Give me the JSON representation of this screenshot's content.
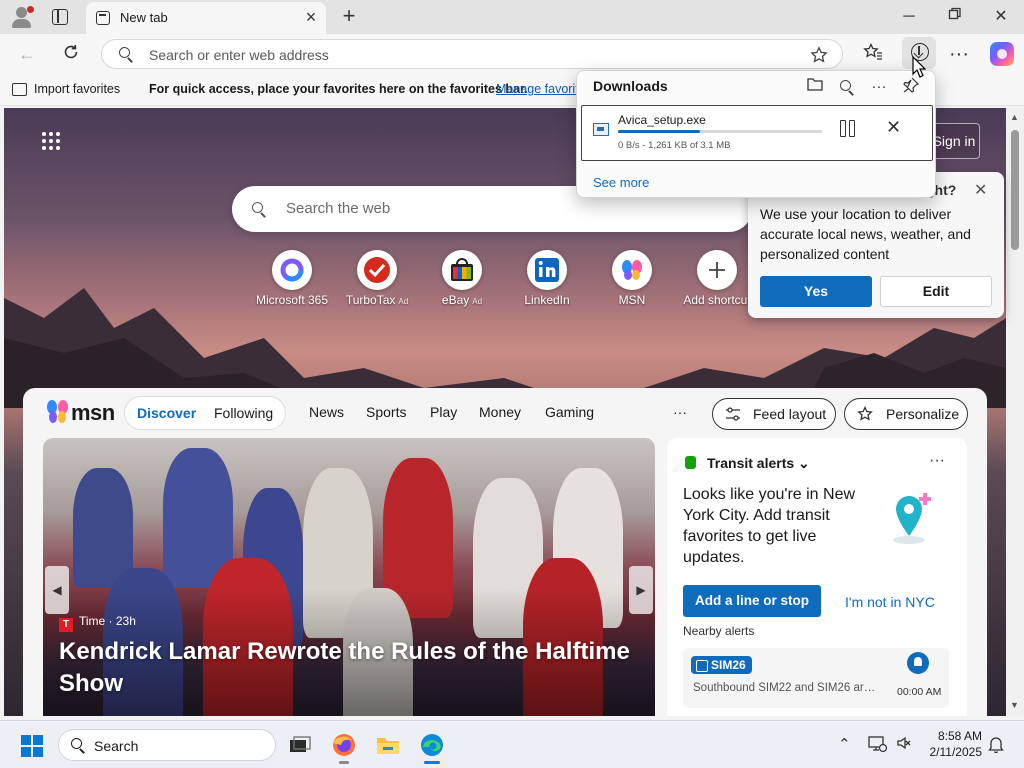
{
  "browser": {
    "tab": {
      "title": "New tab"
    },
    "addressbar": {
      "placeholder": "Search or enter web address"
    },
    "favorites_bar": {
      "import_label": "Import favorites",
      "message": "For quick access, place your favorites here on the favorites bar.",
      "manage_link": "Manage favorites now"
    }
  },
  "downloads": {
    "title": "Downloads",
    "item": {
      "filename": "Avica_setup.exe",
      "status": "0 B/s - 1,261 KB of 3.1 MB",
      "progress_fraction": 0.4
    },
    "see_more": "See more"
  },
  "newtab": {
    "signin": "Sign in",
    "search_placeholder": "Search the web",
    "shortcuts": [
      {
        "label": "Microsoft 365",
        "ad": ""
      },
      {
        "label": "TurboTax",
        "ad": "Ad"
      },
      {
        "label": "eBay",
        "ad": "Ad"
      },
      {
        "label": "LinkedIn",
        "ad": ""
      },
      {
        "label": "MSN",
        "ad": ""
      },
      {
        "label": "Add shortcut",
        "ad": ""
      }
    ],
    "location_prompt": {
      "title_fragment": "ght?",
      "text": "We use your location to deliver accurate local news, weather, and personalized content",
      "yes": "Yes",
      "edit": "Edit"
    }
  },
  "msn": {
    "logo_text": "msn",
    "tabs": [
      "Discover",
      "Following"
    ],
    "links": [
      "News",
      "Sports",
      "Play",
      "Money",
      "Gaming"
    ],
    "more": "···",
    "feed_layout": "Feed layout",
    "personalize": "Personalize",
    "hero": {
      "source": "Time · 23h",
      "source_badge": "T",
      "headline": "Kendrick Lamar Rewrote the Rules of the Halftime Show"
    },
    "transit": {
      "header": "Transit alerts",
      "more": "···",
      "body": "Looks like you're in New York City. Add transit favorites to get live updates.",
      "add_button": "Add a line or stop",
      "not_in_city": "I'm not in NYC",
      "nearby": "Nearby alerts",
      "alert": {
        "route": "SIM26",
        "description": "Southbound SIM22 and SIM26 ar…",
        "time": "00:00 AM"
      }
    }
  },
  "taskbar": {
    "search_label": "Search",
    "time": "8:58 AM",
    "date": "2/11/2025"
  },
  "colors": {
    "accent": "#0f6cbd",
    "transit_green": "#13a10e",
    "time_red": "#e31b23"
  }
}
